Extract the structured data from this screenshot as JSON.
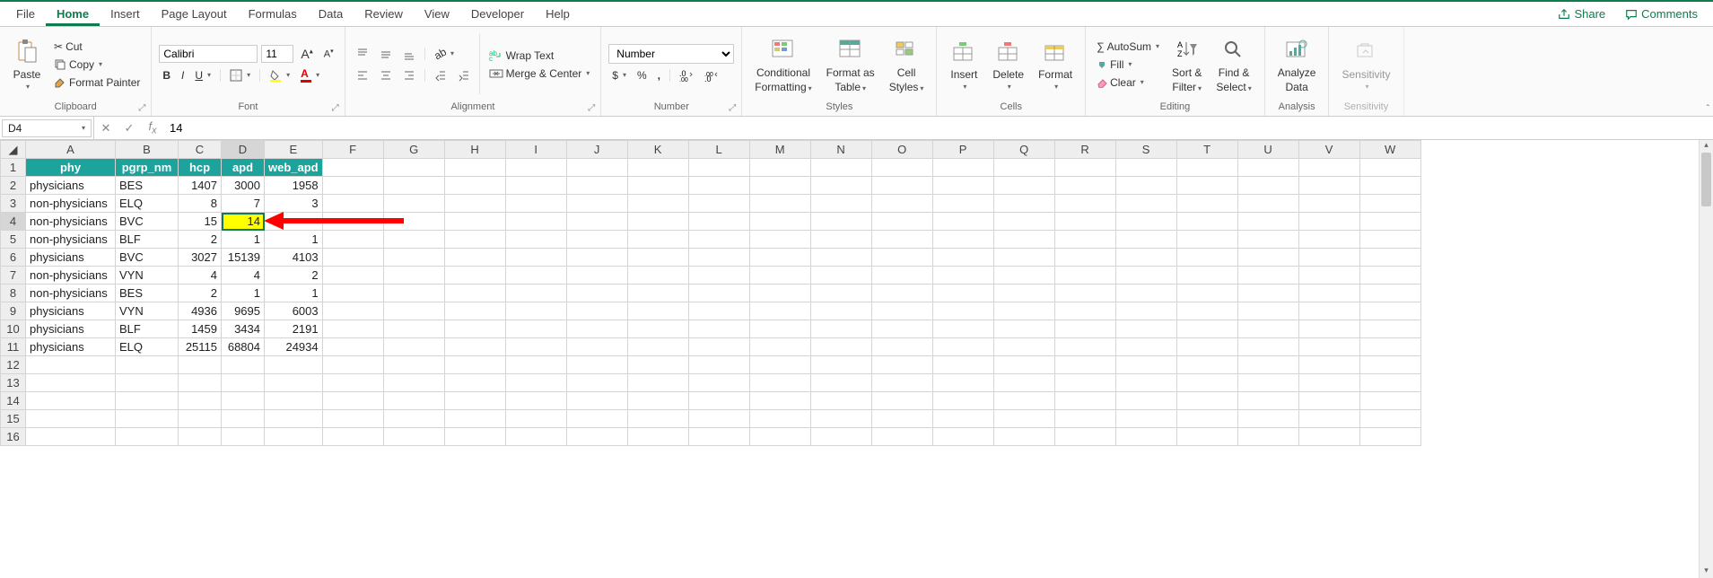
{
  "menu": {
    "tabs": [
      "File",
      "Home",
      "Insert",
      "Page Layout",
      "Formulas",
      "Data",
      "Review",
      "View",
      "Developer",
      "Help"
    ],
    "active": "Home",
    "share": "Share",
    "comments": "Comments"
  },
  "ribbon": {
    "clipboard": {
      "label": "Clipboard",
      "paste": "Paste",
      "cut": "Cut",
      "copy": "Copy",
      "fp": "Format Painter"
    },
    "font": {
      "label": "Font",
      "name": "Calibri",
      "size": "11"
    },
    "alignment": {
      "label": "Alignment",
      "wrap": "Wrap Text",
      "merge": "Merge & Center"
    },
    "number": {
      "label": "Number",
      "format": "Number"
    },
    "styles": {
      "label": "Styles",
      "cf": "Conditional",
      "cf2": "Formatting",
      "fat": "Format as",
      "fat2": "Table",
      "cs": "Cell",
      "cs2": "Styles"
    },
    "cells": {
      "label": "Cells",
      "insert": "Insert",
      "delete": "Delete",
      "format": "Format"
    },
    "editing": {
      "label": "Editing",
      "autosum": "AutoSum",
      "fill": "Fill",
      "clear": "Clear",
      "sort": "Sort &",
      "sort2": "Filter",
      "find": "Find &",
      "find2": "Select"
    },
    "analysis": {
      "label": "Analysis",
      "ad": "Analyze",
      "ad2": "Data"
    },
    "sensitivity": {
      "label": "Sensitivity",
      "s": "Sensitivity"
    }
  },
  "formula_bar": {
    "cell_ref": "D4",
    "value": "14"
  },
  "grid": {
    "columns": [
      "A",
      "B",
      "C",
      "D",
      "E",
      "F",
      "G",
      "H",
      "I",
      "J",
      "K",
      "L",
      "M",
      "N",
      "O",
      "P",
      "Q",
      "R",
      "S",
      "T",
      "U",
      "V",
      "W"
    ],
    "header_row": [
      "phy",
      "pgrp_nm",
      "hcp",
      "apd",
      "web_apd"
    ],
    "rows": [
      {
        "n": 2,
        "a": "physicians",
        "b": "BES",
        "c": "1407",
        "d": "3000",
        "e": "1958"
      },
      {
        "n": 3,
        "a": "non-physicians",
        "b": "ELQ",
        "c": "8",
        "d": "7",
        "e": "3"
      },
      {
        "n": 4,
        "a": "non-physicians",
        "b": "BVC",
        "c": "15",
        "d": "14",
        "e": ""
      },
      {
        "n": 5,
        "a": "non-physicians",
        "b": "BLF",
        "c": "2",
        "d": "1",
        "e": "1"
      },
      {
        "n": 6,
        "a": "physicians",
        "b": "BVC",
        "c": "3027",
        "d": "15139",
        "e": "4103"
      },
      {
        "n": 7,
        "a": "non-physicians",
        "b": "VYN",
        "c": "4",
        "d": "4",
        "e": "2"
      },
      {
        "n": 8,
        "a": "non-physicians",
        "b": "BES",
        "c": "2",
        "d": "1",
        "e": "1"
      },
      {
        "n": 9,
        "a": "physicians",
        "b": "VYN",
        "c": "4936",
        "d": "9695",
        "e": "6003"
      },
      {
        "n": 10,
        "a": "physicians",
        "b": "BLF",
        "c": "1459",
        "d": "3434",
        "e": "2191"
      },
      {
        "n": 11,
        "a": "physicians",
        "b": "ELQ",
        "c": "25115",
        "d": "68804",
        "e": "24934"
      }
    ],
    "empty_rows": [
      12,
      13,
      14,
      15,
      16
    ],
    "selected_cell": "D4",
    "highlighted_cell": "D4"
  }
}
